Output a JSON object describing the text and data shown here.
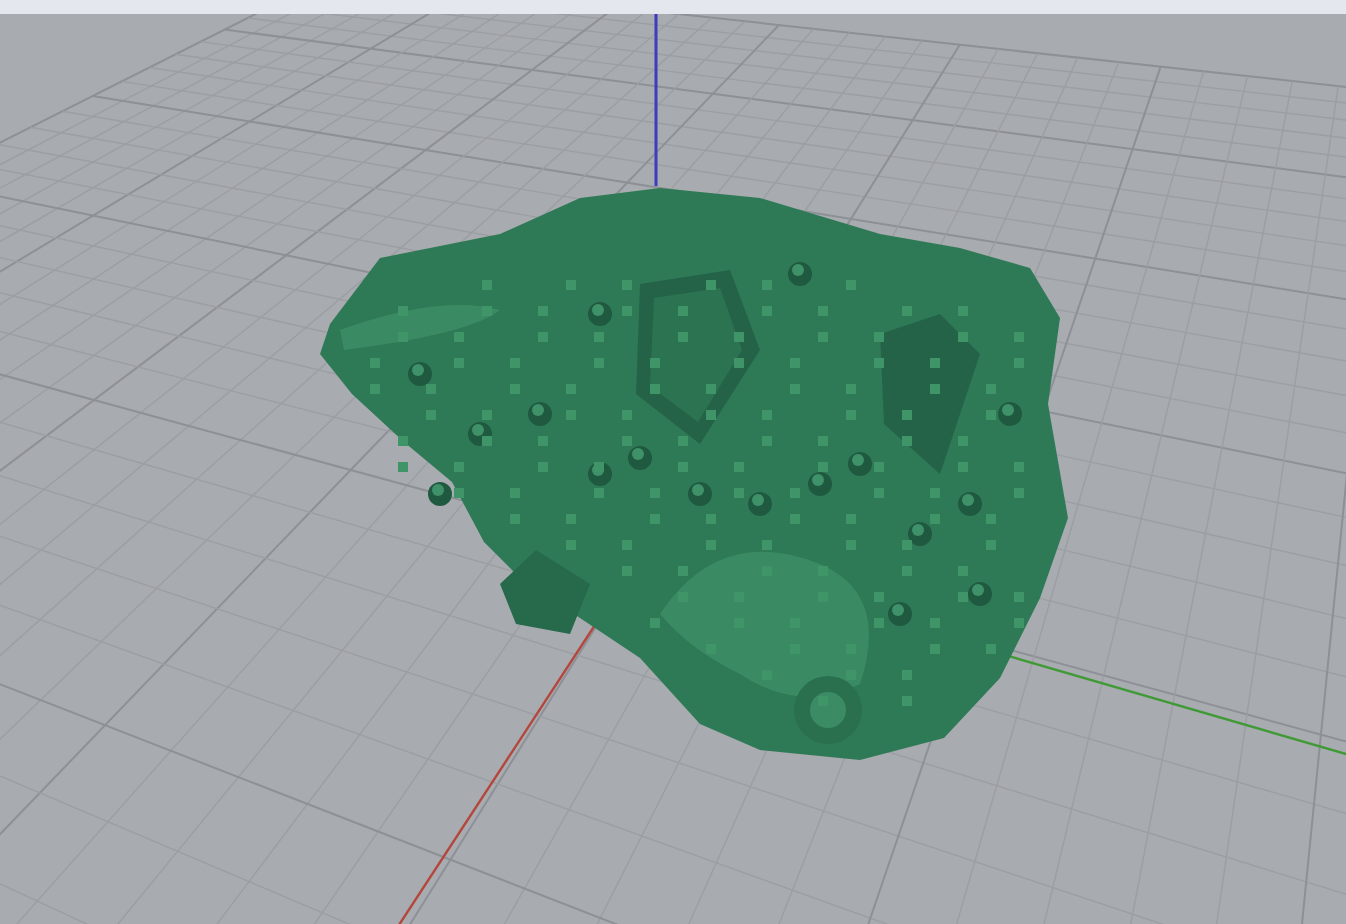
{
  "viewport": {
    "axes": [
      {
        "color": "#b5463c"
      },
      {
        "color": "#3f9a35"
      },
      {
        "color": "#3c3cc0"
      }
    ]
  }
}
